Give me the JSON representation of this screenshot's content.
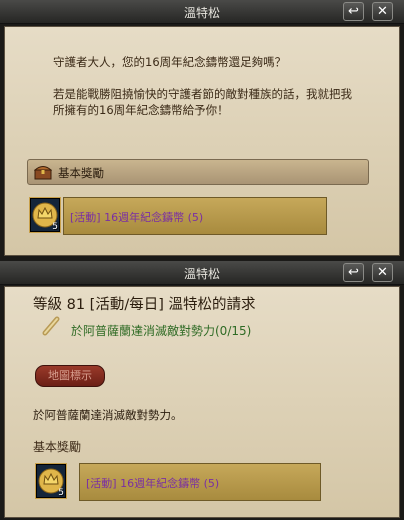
{
  "window1": {
    "title": "溫特松",
    "help_button": "↩",
    "close_button": "✕",
    "dialog_line1": "守護者大人，您的16周年紀念鑄幣還足夠嗎？",
    "dialog_line2": "若是能戰勝阻撓愉快的守護者節的敵對種族的話，我就把我",
    "dialog_line3": "所擁有的16周年紀念鑄幣給予你！",
    "reward_section_label": "基本獎勵",
    "reward_item_label": "[活動] 16週年紀念鑄幣 (5)",
    "reward_item_count": "5"
  },
  "window2": {
    "title": "溫特松",
    "help_button": "↩",
    "close_button": "✕",
    "quest_title": "等級 81 [活動/每日] 溫特松的請求",
    "objective": "於阿普薩蘭達消滅敵對勢力(0/15)",
    "map_button": "地圖標示",
    "description": "於阿普薩蘭達消滅敵對勢力。",
    "reward_heading": "基本獎勵",
    "reward_item_label": "[活動] 16週年紀念鑄幣 (5)",
    "reward_item_count": "5"
  },
  "colors": {
    "panel_bg": "#ddd0b4",
    "item_name_purple": "#7a2fa3",
    "objective_green": "#2f6b25",
    "titlebar_dark": "#262624"
  }
}
